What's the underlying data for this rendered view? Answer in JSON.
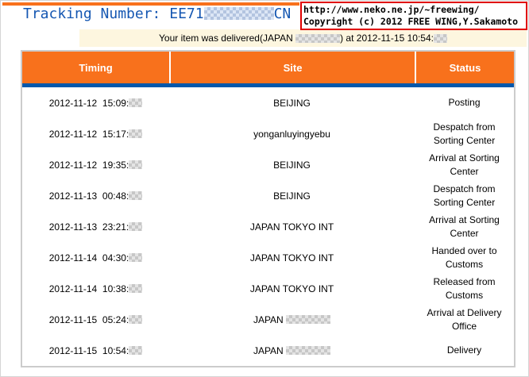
{
  "page": {
    "title_prefix": "Tracking Number: EE71",
    "title_suffix": "CN"
  },
  "copyright": {
    "url": "http://www.neko.ne.jp/~freewing/",
    "credit": "Copyright (c) 2012 FREE WING,Y.Sakamoto"
  },
  "notice": {
    "before": "Your item was delivered(JAPAN ",
    "after": ") at 2012-11-15 10:54:"
  },
  "table": {
    "columns": [
      "Timing",
      "Site",
      "Status"
    ],
    "rows": [
      {
        "timing": "2012-11-12  15:09:",
        "site": "BEIJING",
        "site_censored": false,
        "status": "Posting"
      },
      {
        "timing": "2012-11-12  15:17:",
        "site": "yonganluyingyebu",
        "site_censored": false,
        "status": "Despatch from Sorting Center"
      },
      {
        "timing": "2012-11-12  19:35:",
        "site": "BEIJING",
        "site_censored": false,
        "status": "Arrival at Sorting Center"
      },
      {
        "timing": "2012-11-13  00:48:",
        "site": "BEIJING",
        "site_censored": false,
        "status": "Despatch from Sorting Center"
      },
      {
        "timing": "2012-11-13  23:21:",
        "site": "JAPAN TOKYO INT",
        "site_censored": false,
        "status": "Arrival at Sorting Center"
      },
      {
        "timing": "2012-11-14  04:30:",
        "site": "JAPAN TOKYO INT",
        "site_censored": false,
        "status": "Handed over to Customs"
      },
      {
        "timing": "2012-11-14  10:38:",
        "site": "JAPAN TOKYO INT",
        "site_censored": false,
        "status": "Released from Customs"
      },
      {
        "timing": "2012-11-15  05:24:",
        "site": "JAPAN ",
        "site_censored": true,
        "status": "Arrival at Delivery Office"
      },
      {
        "timing": "2012-11-15  10:54:",
        "site": "JAPAN ",
        "site_censored": true,
        "status": "Delivery"
      }
    ]
  },
  "colors": {
    "accent_orange": "#F8711C",
    "header_bar_blue": "#0458AB",
    "title_blue": "#1557B2",
    "notice_background": "#FDF6DF",
    "copyright_border_red": "#E00000"
  }
}
